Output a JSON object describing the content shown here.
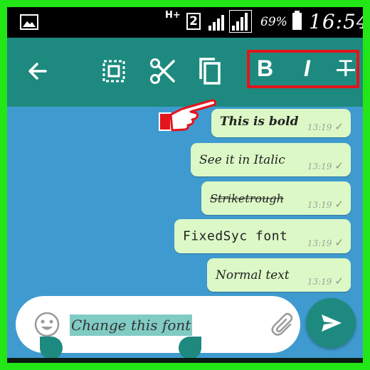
{
  "status_bar": {
    "network_label": "H+",
    "sim_label": "2",
    "battery_percent": "69%",
    "time": "16:54",
    "icons": [
      "image-icon",
      "signal-icon",
      "battery-icon"
    ]
  },
  "action_bar": {
    "icons": [
      "back-arrow-icon",
      "select-all-icon",
      "cut-icon",
      "copy-icon"
    ],
    "format": {
      "bold_label": "B",
      "italic_label": "I",
      "strike_label": "T"
    }
  },
  "messages": [
    {
      "text": "This is bold",
      "time": "13:19",
      "status_icon": "check-icon"
    },
    {
      "text": "See it in Italic",
      "time": "13:19",
      "status_icon": "check-icon"
    },
    {
      "text": "Striketrough",
      "time": "13:19",
      "status_icon": "check-icon"
    },
    {
      "text": "FixedSyc font",
      "time": "13:19",
      "status_icon": "check-icon"
    },
    {
      "text": "Normal text",
      "time": "13:19",
      "status_icon": "check-icon"
    }
  ],
  "composer": {
    "selected_text": "Change this font",
    "icons": [
      "emoji-icon",
      "attachment-icon",
      "send-icon"
    ]
  },
  "colors": {
    "border_green": "#22e616",
    "toolbar_teal": "#1e8a7f",
    "chat_blue": "#3f9bcf",
    "bubble_green": "#dcf8c6",
    "highlight_red": "#e4141c",
    "selection_teal": "#80cbc4"
  }
}
